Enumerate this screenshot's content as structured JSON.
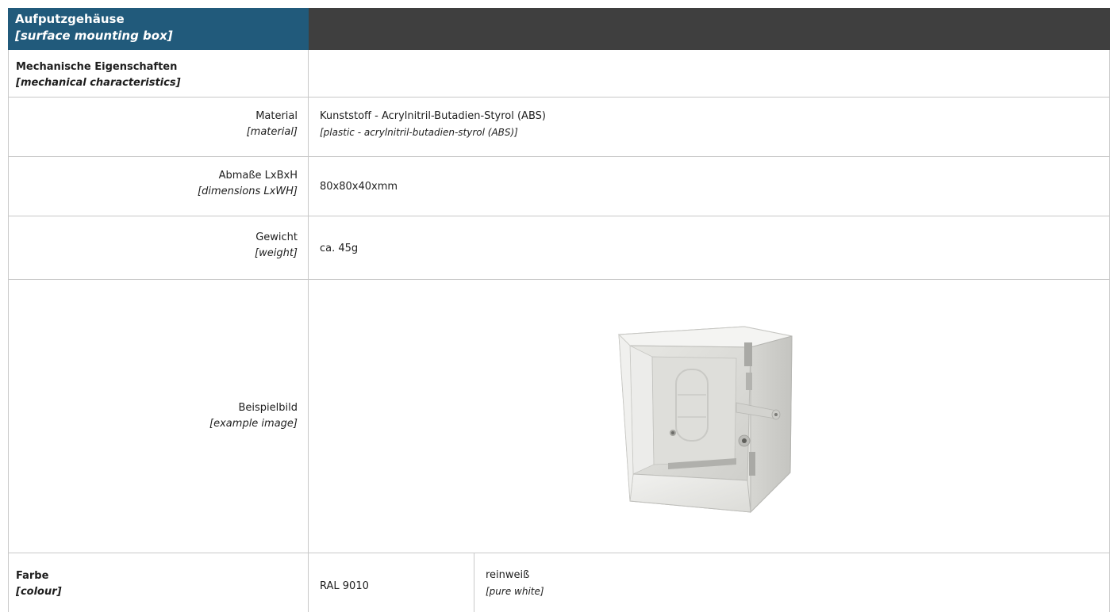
{
  "header": {
    "title_de": "Aufputzgehäuse",
    "title_en": "[surface mounting box]",
    "right_color": "#3f3f3f",
    "left_color": "#215a7b"
  },
  "section": {
    "label_de": "Mechanische Eigenschaften",
    "label_en": "[mechanical characteristics]"
  },
  "rows": {
    "material": {
      "label_de": "Material",
      "label_en": "[material]",
      "value_de": "Kunststoff - Acrylnitril-Butadien-Styrol (ABS)",
      "value_en": "[plastic - acrylnitril-butadien-styrol (ABS)]"
    },
    "dimensions": {
      "label_de": "Abmaße LxBxH",
      "label_en": "[dimensions LxWH]",
      "value": "80x80x40xmm"
    },
    "weight": {
      "label_de": "Gewicht",
      "label_en": "[weight]",
      "value": "ca. 45g"
    },
    "image": {
      "label_de": "Beispielbild",
      "label_en": "[example image]",
      "icon": "surface-mounting-box-photo"
    }
  },
  "colour": {
    "label_de": "Farbe",
    "label_en": "[colour]",
    "ral": "RAL 9010",
    "name_de": "reinweiß",
    "name_en": "[pure white]"
  }
}
